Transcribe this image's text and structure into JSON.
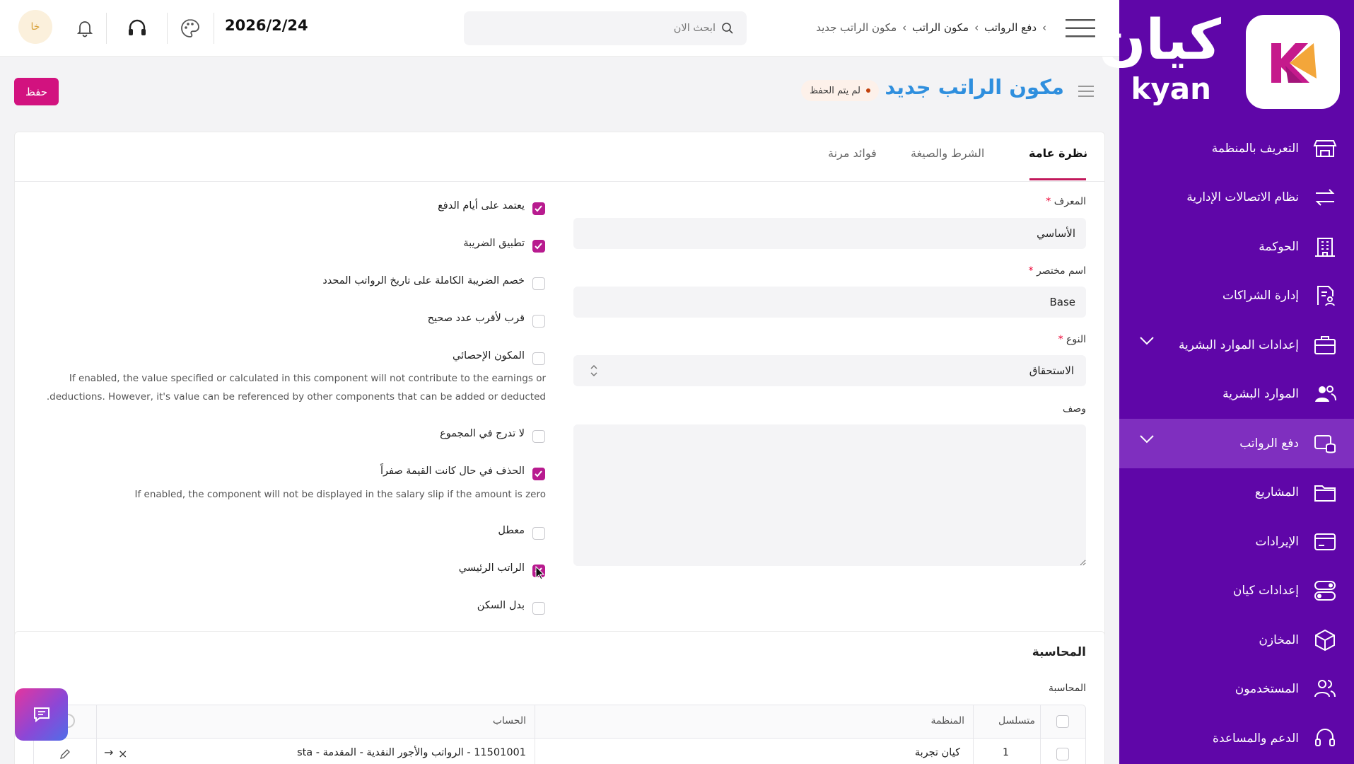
{
  "sidebar": {
    "logo_ar": "كيان",
    "logo_en": "kyan",
    "items": [
      {
        "label": "التعريف بالمنظمة",
        "icon": "store-icon",
        "chevron": false,
        "active": false
      },
      {
        "label": "نظام الاتصالات الإدارية",
        "icon": "transfer-arrows-icon",
        "chevron": false,
        "active": false
      },
      {
        "label": "الحوكمة",
        "icon": "building-icon",
        "chevron": false,
        "active": false
      },
      {
        "label": "إدارة الشراكات",
        "icon": "document-user-icon",
        "chevron": false,
        "active": false
      },
      {
        "label": "إعدادات الموارد البشرية",
        "icon": "briefcase-icon",
        "chevron": true,
        "active": false
      },
      {
        "label": "الموارد البشرية",
        "icon": "users-icon",
        "chevron": false,
        "active": false
      },
      {
        "label": "دفع الرواتب",
        "icon": "payroll-coins-icon",
        "chevron": true,
        "active": true
      },
      {
        "label": "المشاريع",
        "icon": "folder-icon",
        "chevron": false,
        "active": false
      },
      {
        "label": "الإيرادات",
        "icon": "card-icon",
        "chevron": false,
        "active": false
      },
      {
        "label": "إعدادات كيان",
        "icon": "toggle-settings-icon",
        "chevron": false,
        "active": false
      },
      {
        "label": "المخازن",
        "icon": "box-icon",
        "chevron": false,
        "active": false
      },
      {
        "label": "المستخدمون",
        "icon": "user-group-icon",
        "chevron": false,
        "active": false
      },
      {
        "label": "الدعم والمساعدة",
        "icon": "headset-icon",
        "chevron": false,
        "active": false
      }
    ]
  },
  "topbar": {
    "breadcrumb": [
      "دفع الرواتب",
      "مكون الراتب",
      "مكون الراتب جديد"
    ],
    "search_placeholder": "ابحث الان",
    "date": "2026/2/24",
    "avatar_initials": "خا"
  },
  "page": {
    "title": "مكون الراتب جديد",
    "status": "لم يتم الحفظ",
    "save_label": "حفظ"
  },
  "tabs": [
    "نظرة عامة",
    "الشرط والصيغة",
    "فوائد مرنة"
  ],
  "form": {
    "id_label": "المعرف",
    "id_value": "الأساسي",
    "abbr_label": "اسم مختصر",
    "abbr_value": "Base",
    "type_label": "النوع",
    "type_value": "الاستحقاق",
    "desc_label": "وصف"
  },
  "checkboxes": [
    {
      "label": "يعتمد على أيام الدفع",
      "checked": true
    },
    {
      "label": "تطبيق الضريبة",
      "checked": true
    },
    {
      "label": "خصم الضريبة الكاملة على تاريخ الرواتب المحدد",
      "checked": false
    },
    {
      "label": "قرب لأقرب عدد صحيح",
      "checked": false
    },
    {
      "label": "المكون الإحصائي",
      "checked": false
    },
    {
      "label": "لا تدرج في المجموع",
      "checked": false
    },
    {
      "label": "الحذف في حال كانت القيمة صفراً",
      "checked": true
    },
    {
      "label": "معطل",
      "checked": false
    },
    {
      "label": "الراتب الرئيسي",
      "checked": true
    },
    {
      "label": "بدل السكن",
      "checked": false
    }
  ],
  "help": {
    "statistical_1": "If enabled, the value specified or calculated in this component will not contribute to the earnings or",
    "statistical_2": ".deductions. However, it's value can be referenced by other components that can be added or deducted",
    "zero": "If enabled, the component will not be displayed in the salary slip if the amount is zero"
  },
  "accounting": {
    "section_title": "المحاسبة",
    "table_label": "المحاسبة",
    "columns": [
      "متسلسل",
      "المنظمة",
      "الحساب"
    ],
    "rows": [
      {
        "no": "1",
        "org": "كيان تجربة",
        "account": "11501001 - الرواتب والأجور النقدية - المقدمة - sta"
      }
    ]
  },
  "colors": {
    "sidebar": "#5f06a8",
    "accent": "#b81b8f",
    "title": "#2f8fde"
  }
}
